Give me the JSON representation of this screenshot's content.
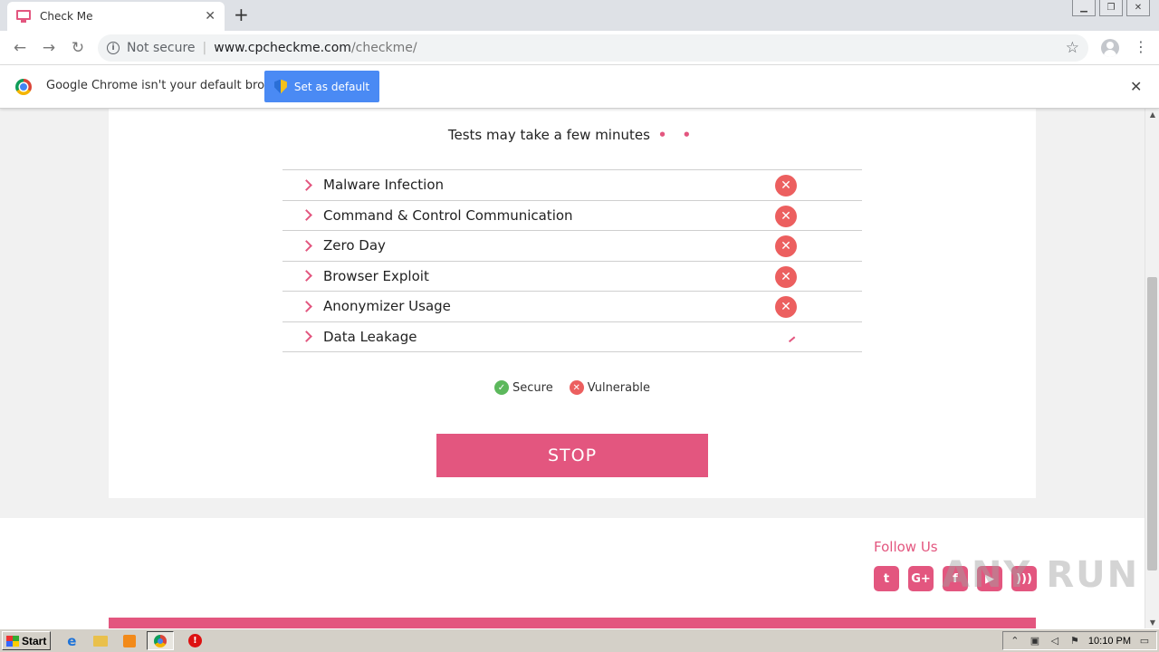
{
  "browser": {
    "tab_title": "Check Me",
    "tab_close": "✕",
    "new_tab": "+",
    "security_label": "Not secure",
    "url_host": "www.cpcheckme.com",
    "url_path": "/checkme/"
  },
  "infobar": {
    "message": "Google Chrome isn't your default browser",
    "button_label": "Set as default",
    "close": "✕"
  },
  "page": {
    "status_text": "Tests may take a few minutes",
    "status_dots": "• •",
    "tests": [
      {
        "label": "Malware Infection",
        "status": "vulnerable"
      },
      {
        "label": "Command & Control Communication",
        "status": "vulnerable"
      },
      {
        "label": "Zero Day",
        "status": "vulnerable"
      },
      {
        "label": "Browser Exploit",
        "status": "vulnerable"
      },
      {
        "label": "Anonymizer Usage",
        "status": "vulnerable"
      },
      {
        "label": "Data Leakage",
        "status": "in-progress"
      }
    ],
    "legend": {
      "secure": "Secure",
      "vulnerable": "Vulnerable"
    },
    "stop_label": "STOP",
    "follow_title": "Follow Us",
    "social": [
      "twitter-icon",
      "google-plus-icon",
      "facebook-icon",
      "youtube-icon",
      "rss-icon"
    ],
    "social_glyphs": {
      "twitter": "t",
      "google_plus": "G+",
      "facebook": "f",
      "youtube": "▶",
      "rss": ")))"
    },
    "watermark": "ANY RUN",
    "accent_color": "#e3567f",
    "fail_color": "#ec5f5f",
    "ok_color": "#5cb85c"
  },
  "taskbar": {
    "start_label": "Start",
    "clock": "10:10 PM"
  }
}
